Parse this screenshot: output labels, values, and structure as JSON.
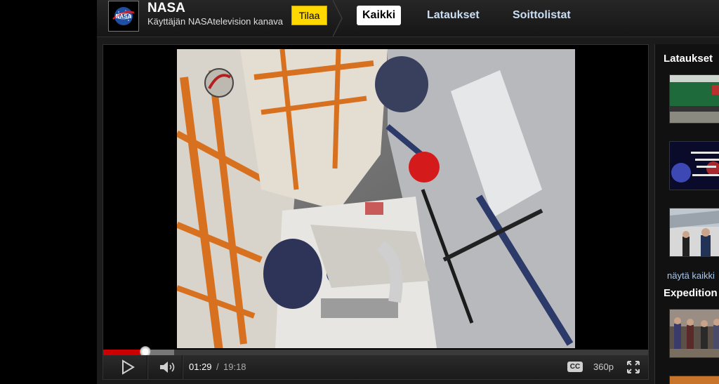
{
  "channel": {
    "name": "NASA",
    "subtitle": "Käyttäjän NASAtelevision kanava",
    "logo_text": "NASA",
    "subscribe_label": "Tilaa"
  },
  "tabs": [
    {
      "label": "Kaikki",
      "active": true
    },
    {
      "label": "Lataukset",
      "active": false
    },
    {
      "label": "Soittolistat",
      "active": false
    }
  ],
  "player": {
    "current_time": "01:29",
    "separator": "/",
    "duration": "19:18",
    "progress_fraction": 0.077,
    "buffered_fraction": 0.13,
    "cc_label": "CC",
    "quality_label": "360p"
  },
  "sidebar": {
    "section1_title": "Lataukset",
    "show_all_label": "näytä kaikki",
    "section2_title": "Expedition"
  },
  "colors": {
    "subscribe": "#ffd800",
    "progress_played": "#cc0000",
    "tab_text": "#c9dff5",
    "link": "#a9c8ea"
  },
  "icons": {
    "play": "play-icon",
    "volume": "volume-icon",
    "fullscreen": "fullscreen-icon"
  }
}
